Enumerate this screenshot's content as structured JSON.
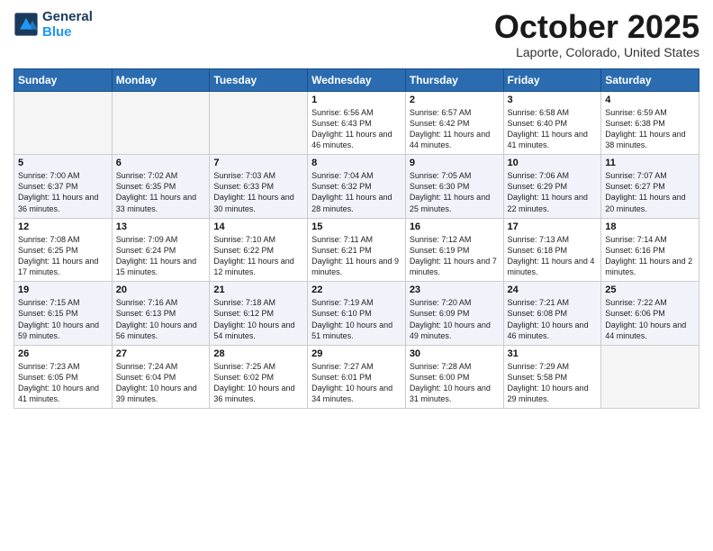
{
  "header": {
    "logo_line1": "General",
    "logo_line2": "Blue",
    "month": "October 2025",
    "location": "Laporte, Colorado, United States"
  },
  "weekdays": [
    "Sunday",
    "Monday",
    "Tuesday",
    "Wednesday",
    "Thursday",
    "Friday",
    "Saturday"
  ],
  "weeks": [
    [
      {
        "day": "",
        "info": ""
      },
      {
        "day": "",
        "info": ""
      },
      {
        "day": "",
        "info": ""
      },
      {
        "day": "1",
        "info": "Sunrise: 6:56 AM\nSunset: 6:43 PM\nDaylight: 11 hours\nand 46 minutes."
      },
      {
        "day": "2",
        "info": "Sunrise: 6:57 AM\nSunset: 6:42 PM\nDaylight: 11 hours\nand 44 minutes."
      },
      {
        "day": "3",
        "info": "Sunrise: 6:58 AM\nSunset: 6:40 PM\nDaylight: 11 hours\nand 41 minutes."
      },
      {
        "day": "4",
        "info": "Sunrise: 6:59 AM\nSunset: 6:38 PM\nDaylight: 11 hours\nand 38 minutes."
      }
    ],
    [
      {
        "day": "5",
        "info": "Sunrise: 7:00 AM\nSunset: 6:37 PM\nDaylight: 11 hours\nand 36 minutes."
      },
      {
        "day": "6",
        "info": "Sunrise: 7:02 AM\nSunset: 6:35 PM\nDaylight: 11 hours\nand 33 minutes."
      },
      {
        "day": "7",
        "info": "Sunrise: 7:03 AM\nSunset: 6:33 PM\nDaylight: 11 hours\nand 30 minutes."
      },
      {
        "day": "8",
        "info": "Sunrise: 7:04 AM\nSunset: 6:32 PM\nDaylight: 11 hours\nand 28 minutes."
      },
      {
        "day": "9",
        "info": "Sunrise: 7:05 AM\nSunset: 6:30 PM\nDaylight: 11 hours\nand 25 minutes."
      },
      {
        "day": "10",
        "info": "Sunrise: 7:06 AM\nSunset: 6:29 PM\nDaylight: 11 hours\nand 22 minutes."
      },
      {
        "day": "11",
        "info": "Sunrise: 7:07 AM\nSunset: 6:27 PM\nDaylight: 11 hours\nand 20 minutes."
      }
    ],
    [
      {
        "day": "12",
        "info": "Sunrise: 7:08 AM\nSunset: 6:25 PM\nDaylight: 11 hours\nand 17 minutes."
      },
      {
        "day": "13",
        "info": "Sunrise: 7:09 AM\nSunset: 6:24 PM\nDaylight: 11 hours\nand 15 minutes."
      },
      {
        "day": "14",
        "info": "Sunrise: 7:10 AM\nSunset: 6:22 PM\nDaylight: 11 hours\nand 12 minutes."
      },
      {
        "day": "15",
        "info": "Sunrise: 7:11 AM\nSunset: 6:21 PM\nDaylight: 11 hours\nand 9 minutes."
      },
      {
        "day": "16",
        "info": "Sunrise: 7:12 AM\nSunset: 6:19 PM\nDaylight: 11 hours\nand 7 minutes."
      },
      {
        "day": "17",
        "info": "Sunrise: 7:13 AM\nSunset: 6:18 PM\nDaylight: 11 hours\nand 4 minutes."
      },
      {
        "day": "18",
        "info": "Sunrise: 7:14 AM\nSunset: 6:16 PM\nDaylight: 11 hours\nand 2 minutes."
      }
    ],
    [
      {
        "day": "19",
        "info": "Sunrise: 7:15 AM\nSunset: 6:15 PM\nDaylight: 10 hours\nand 59 minutes."
      },
      {
        "day": "20",
        "info": "Sunrise: 7:16 AM\nSunset: 6:13 PM\nDaylight: 10 hours\nand 56 minutes."
      },
      {
        "day": "21",
        "info": "Sunrise: 7:18 AM\nSunset: 6:12 PM\nDaylight: 10 hours\nand 54 minutes."
      },
      {
        "day": "22",
        "info": "Sunrise: 7:19 AM\nSunset: 6:10 PM\nDaylight: 10 hours\nand 51 minutes."
      },
      {
        "day": "23",
        "info": "Sunrise: 7:20 AM\nSunset: 6:09 PM\nDaylight: 10 hours\nand 49 minutes."
      },
      {
        "day": "24",
        "info": "Sunrise: 7:21 AM\nSunset: 6:08 PM\nDaylight: 10 hours\nand 46 minutes."
      },
      {
        "day": "25",
        "info": "Sunrise: 7:22 AM\nSunset: 6:06 PM\nDaylight: 10 hours\nand 44 minutes."
      }
    ],
    [
      {
        "day": "26",
        "info": "Sunrise: 7:23 AM\nSunset: 6:05 PM\nDaylight: 10 hours\nand 41 minutes."
      },
      {
        "day": "27",
        "info": "Sunrise: 7:24 AM\nSunset: 6:04 PM\nDaylight: 10 hours\nand 39 minutes."
      },
      {
        "day": "28",
        "info": "Sunrise: 7:25 AM\nSunset: 6:02 PM\nDaylight: 10 hours\nand 36 minutes."
      },
      {
        "day": "29",
        "info": "Sunrise: 7:27 AM\nSunset: 6:01 PM\nDaylight: 10 hours\nand 34 minutes."
      },
      {
        "day": "30",
        "info": "Sunrise: 7:28 AM\nSunset: 6:00 PM\nDaylight: 10 hours\nand 31 minutes."
      },
      {
        "day": "31",
        "info": "Sunrise: 7:29 AM\nSunset: 5:58 PM\nDaylight: 10 hours\nand 29 minutes."
      },
      {
        "day": "",
        "info": ""
      }
    ]
  ]
}
